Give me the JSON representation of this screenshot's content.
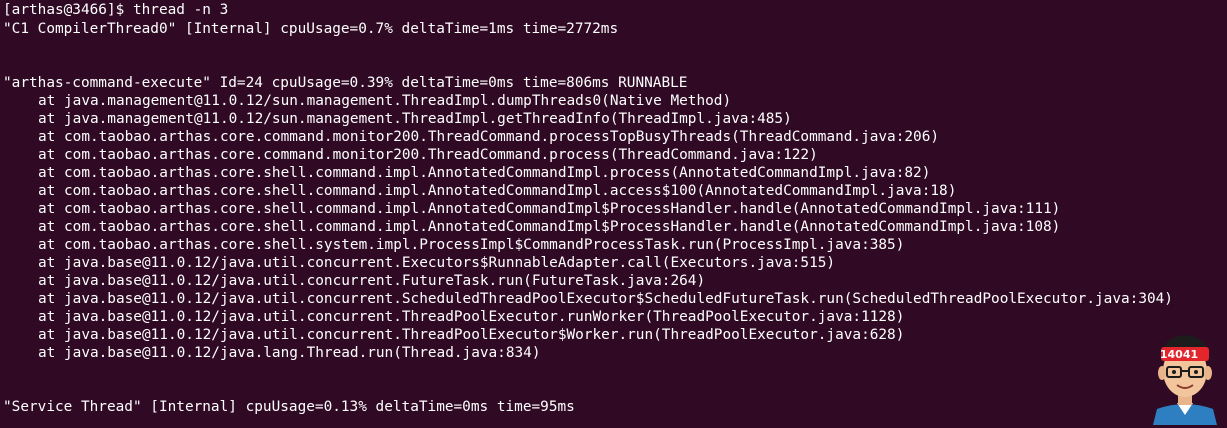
{
  "terminal": {
    "prompt": "[arthas@3466]$ thread -n 3",
    "thread1_header": "\"C1 CompilerThread0\" [Internal] cpuUsage=0.7% deltaTime=1ms time=2772ms",
    "thread2_header": "\"arthas-command-execute\" Id=24 cpuUsage=0.39% deltaTime=0ms time=806ms RUNNABLE",
    "thread2_frames": [
      "at java.management@11.0.12/sun.management.ThreadImpl.dumpThreads0(Native Method)",
      "at java.management@11.0.12/sun.management.ThreadImpl.getThreadInfo(ThreadImpl.java:485)",
      "at com.taobao.arthas.core.command.monitor200.ThreadCommand.processTopBusyThreads(ThreadCommand.java:206)",
      "at com.taobao.arthas.core.command.monitor200.ThreadCommand.process(ThreadCommand.java:122)",
      "at com.taobao.arthas.core.shell.command.impl.AnnotatedCommandImpl.process(AnnotatedCommandImpl.java:82)",
      "at com.taobao.arthas.core.shell.command.impl.AnnotatedCommandImpl.access$100(AnnotatedCommandImpl.java:18)",
      "at com.taobao.arthas.core.shell.command.impl.AnnotatedCommandImpl$ProcessHandler.handle(AnnotatedCommandImpl.java:111)",
      "at com.taobao.arthas.core.shell.command.impl.AnnotatedCommandImpl$ProcessHandler.handle(AnnotatedCommandImpl.java:108)",
      "at com.taobao.arthas.core.shell.system.impl.ProcessImpl$CommandProcessTask.run(ProcessImpl.java:385)",
      "at java.base@11.0.12/java.util.concurrent.Executors$RunnableAdapter.call(Executors.java:515)",
      "at java.base@11.0.12/java.util.concurrent.FutureTask.run(FutureTask.java:264)",
      "at java.base@11.0.12/java.util.concurrent.ScheduledThreadPoolExecutor$ScheduledFutureTask.run(ScheduledThreadPoolExecutor.java:304)",
      "at java.base@11.0.12/java.util.concurrent.ThreadPoolExecutor.runWorker(ThreadPoolExecutor.java:1128)",
      "at java.base@11.0.12/java.util.concurrent.ThreadPoolExecutor$Worker.run(ThreadPoolExecutor.java:628)",
      "at java.base@11.0.12/java.lang.Thread.run(Thread.java:834)"
    ],
    "thread3_header": "\"Service Thread\" [Internal] cpuUsage=0.13% deltaTime=0ms time=95ms"
  },
  "watermark": {
    "badge_text": "14041",
    "icon": "avatar-icon"
  },
  "colors": {
    "background": "#300a24",
    "text": "#ffffff",
    "headband": "#e3262b"
  }
}
